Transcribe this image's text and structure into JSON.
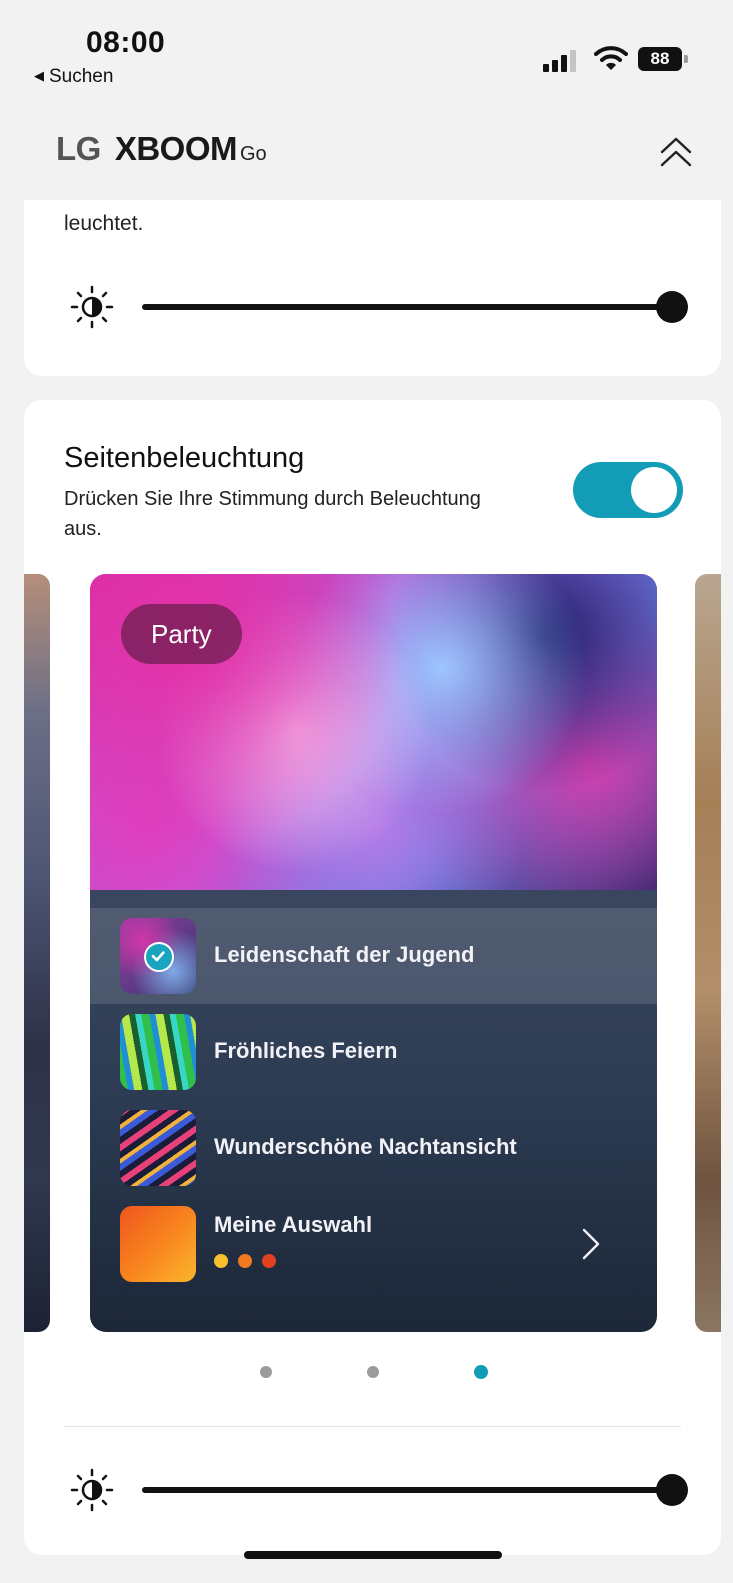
{
  "status_bar": {
    "time": "08:00",
    "back_app": "Suchen",
    "battery": "88",
    "signal_bars": 3,
    "icons": [
      "signal-icon",
      "wifi-icon",
      "battery-icon"
    ]
  },
  "header": {
    "brand_lg": "LG",
    "brand_xboom": "XBOOM",
    "brand_go": "Go",
    "collapse_icon": "double-chevron-up-icon"
  },
  "brightness_card": {
    "partial_text": "leuchtet.",
    "brightness_level": 1.0,
    "icon": "brightness-icon"
  },
  "side_lighting": {
    "title": "Seitenbeleuchtung",
    "description": "Drücken Sie Ihre Stimmung durch Beleuchtung aus.",
    "enabled": true,
    "accent_color": "#139cb6",
    "mood_card": {
      "badge": "Party",
      "items": [
        {
          "label": "Leidenschaft der Jugend",
          "selected": true
        },
        {
          "label": "Fröhliches Feiern",
          "selected": false
        },
        {
          "label": "Wunderschöne Nachtansicht",
          "selected": false
        },
        {
          "label": "Meine Auswahl",
          "selected": false,
          "colors": [
            "#f7c02c",
            "#f07a1f",
            "#e2401f"
          ]
        }
      ]
    },
    "pager": {
      "count": 3,
      "active_index": 2
    },
    "brightness_level": 1.0
  }
}
